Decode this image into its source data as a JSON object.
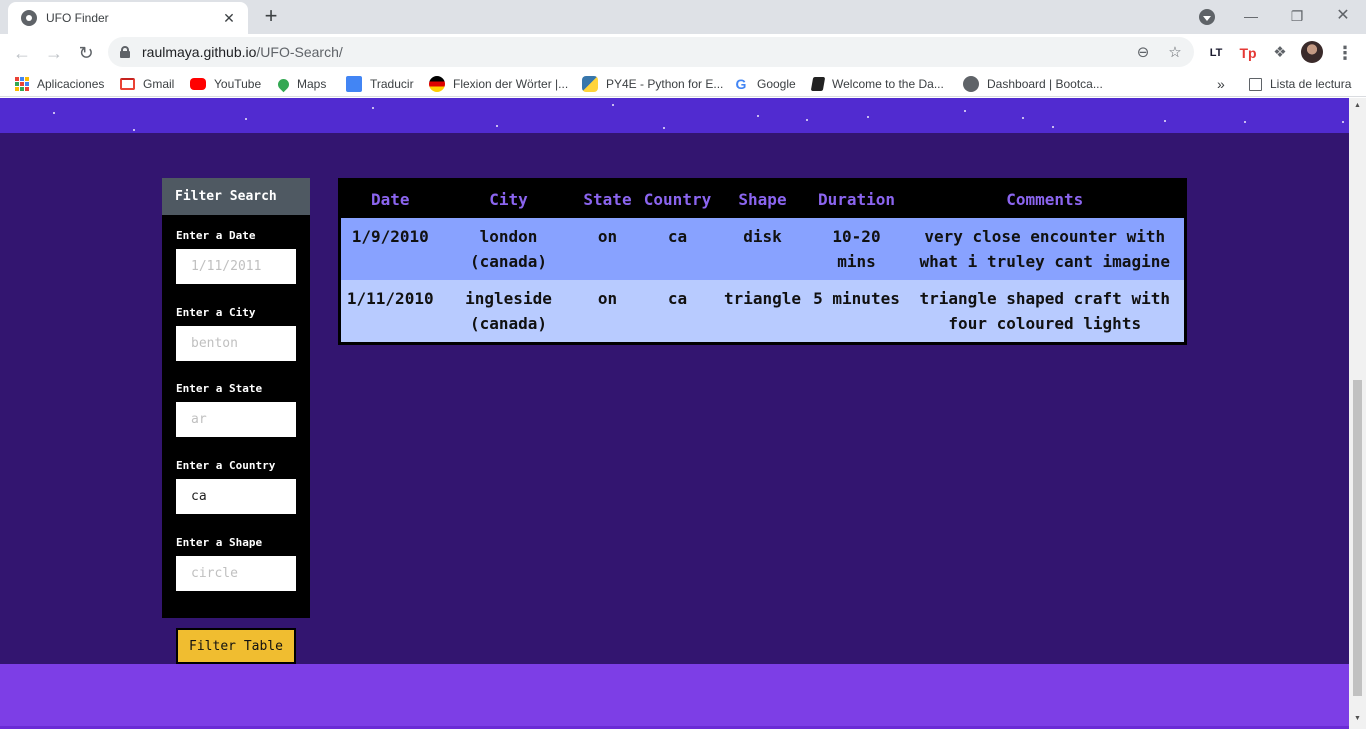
{
  "browser": {
    "tab_title": "UFO Finder",
    "url_host": "raulmaya.github.io",
    "url_path": "/UFO-Search/",
    "bookmarks": [
      "Aplicaciones",
      "Gmail",
      "YouTube",
      "Maps",
      "Traducir",
      "Flexion der Wörter |...",
      "PY4E - Python for E...",
      "Google",
      "Welcome to the Da...",
      "Dashboard | Bootca..."
    ],
    "reading_list": "Lista de lectura"
  },
  "filters": {
    "header": "Filter Search",
    "fields": [
      {
        "label": "Enter a Date",
        "placeholder": "1/11/2011",
        "value": ""
      },
      {
        "label": "Enter a City",
        "placeholder": "benton",
        "value": ""
      },
      {
        "label": "Enter a State",
        "placeholder": "ar",
        "value": ""
      },
      {
        "label": "Enter a Country",
        "placeholder": "",
        "value": "ca"
      },
      {
        "label": "Enter a Shape",
        "placeholder": "circle",
        "value": ""
      }
    ],
    "button_label": "Filter Table"
  },
  "table": {
    "columns": [
      "Date",
      "City",
      "State",
      "Country",
      "Shape",
      "Duration",
      "Comments"
    ],
    "rows": [
      {
        "date": "1/9/2010",
        "city": "london (canada)",
        "state": "on",
        "country": "ca",
        "shape": "disk",
        "duration": "10-20 mins",
        "comments": "very close encounter with what i truley cant imagine"
      },
      {
        "date": "1/11/2010",
        "city": "ingleside (canada)",
        "state": "on",
        "country": "ca",
        "shape": "triangle",
        "duration": "5 minutes",
        "comments": "triangle shaped craft with four coloured lights"
      }
    ]
  }
}
